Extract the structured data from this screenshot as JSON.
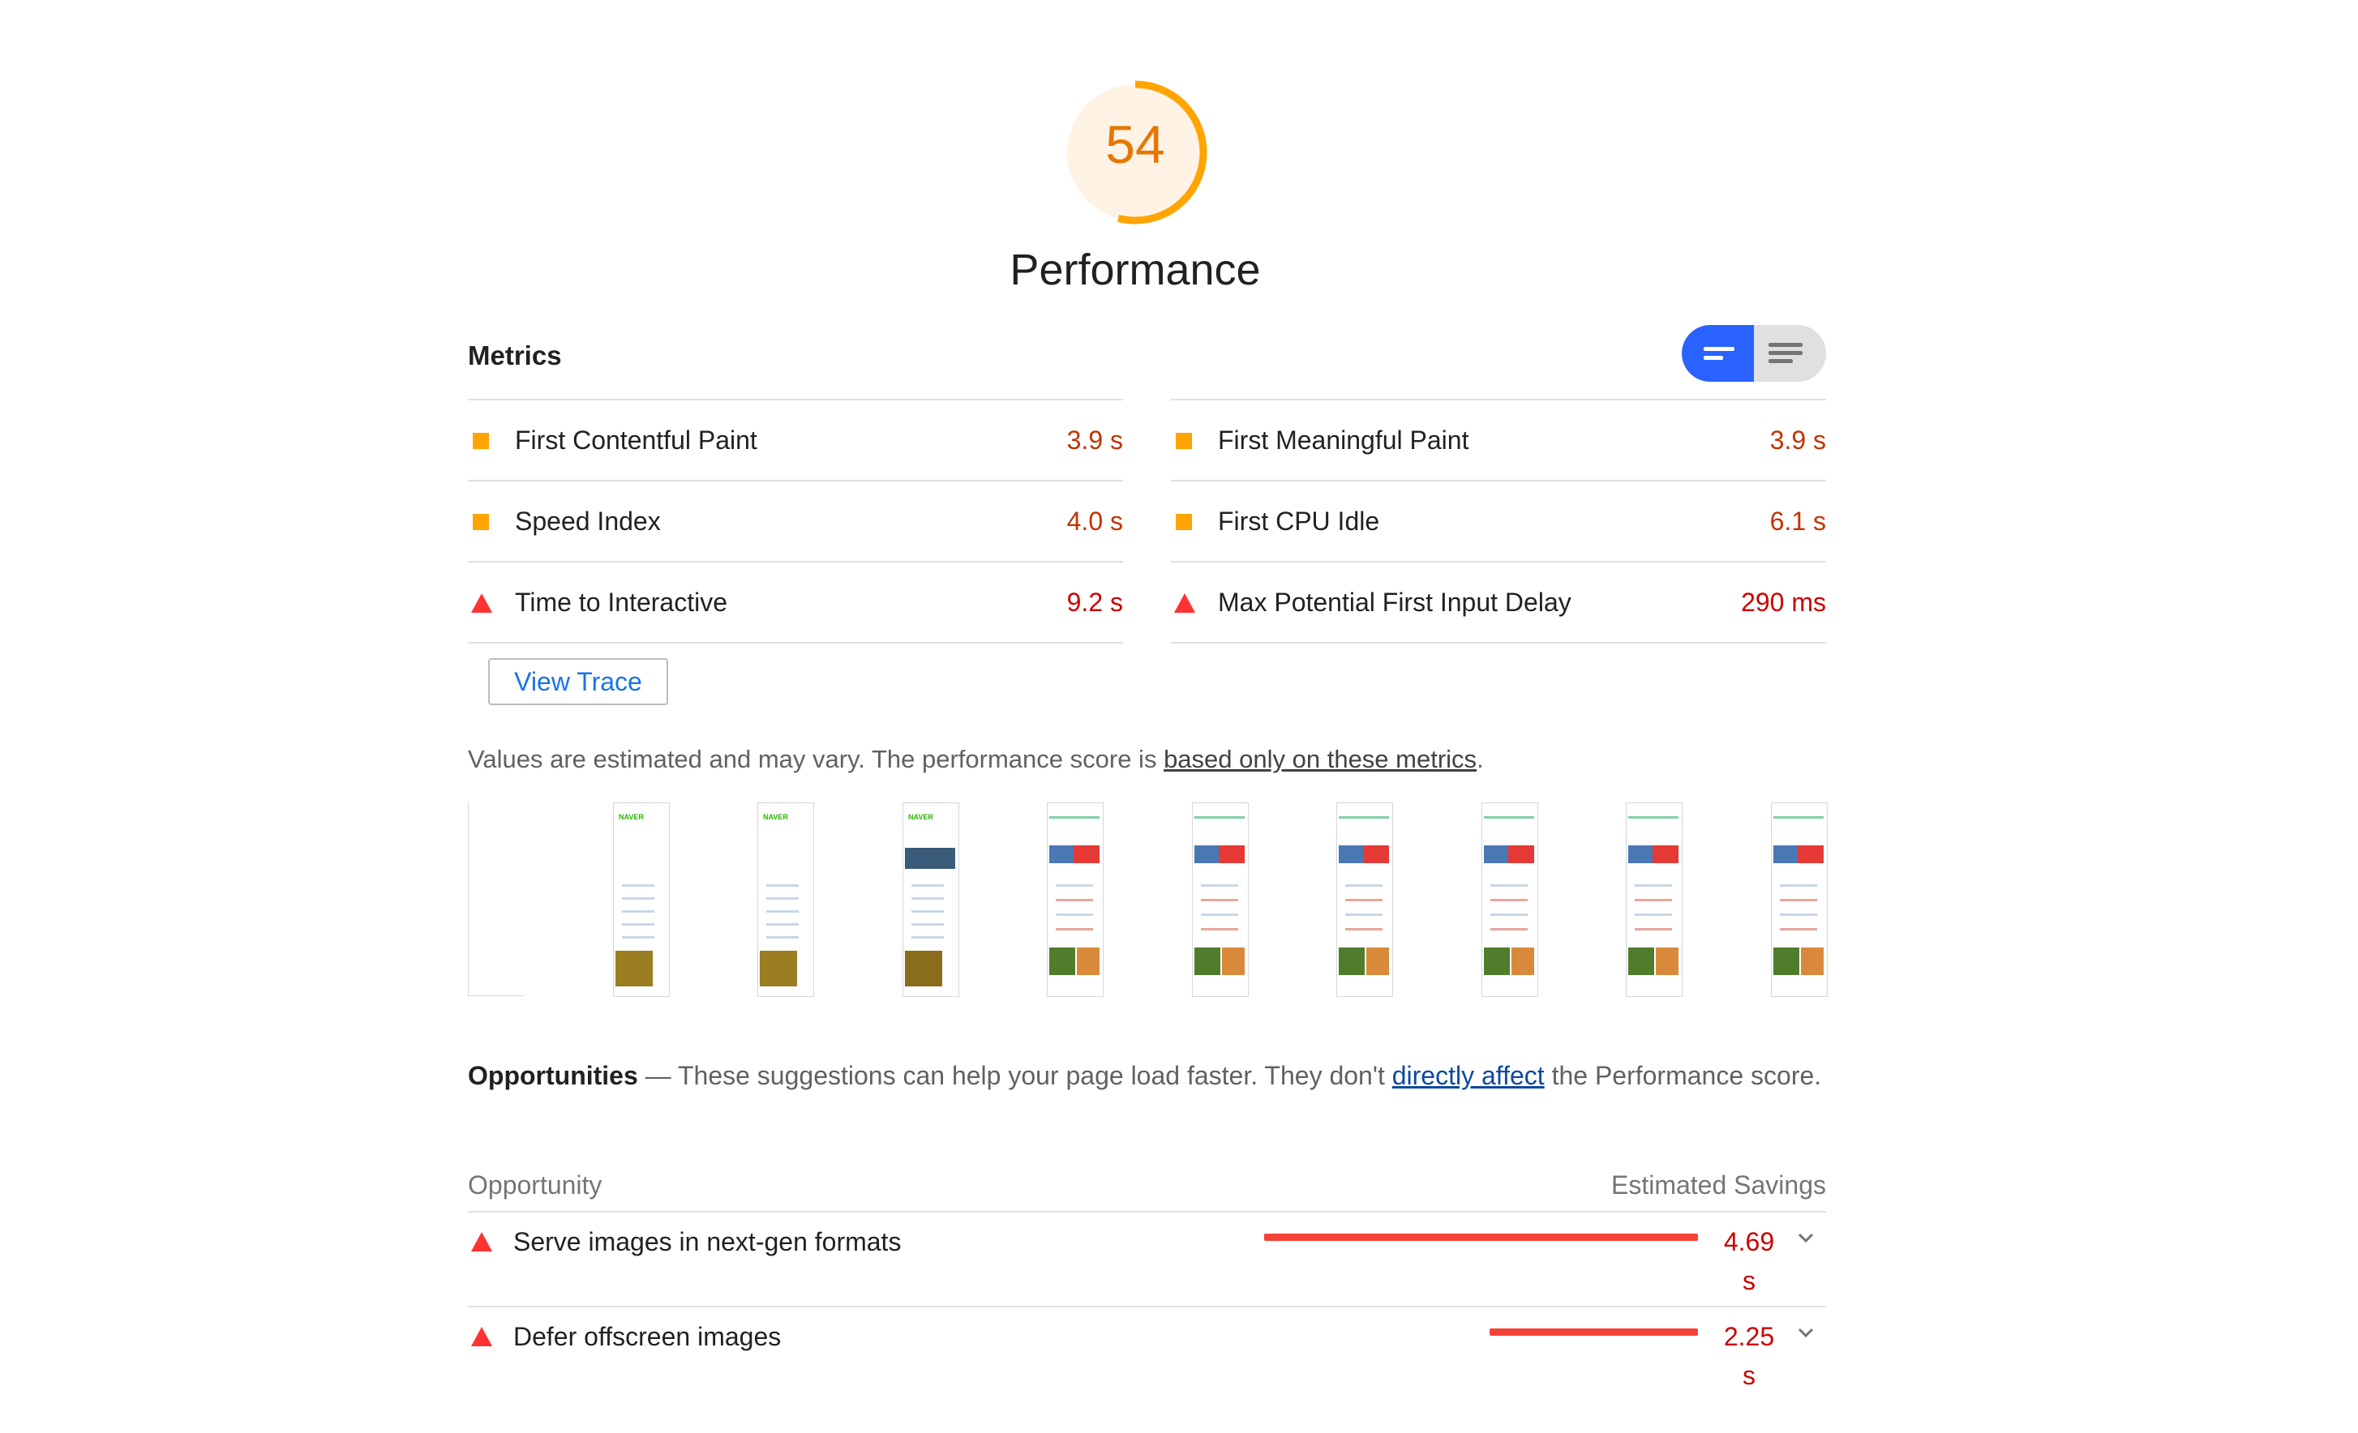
{
  "gauge": {
    "score": "54",
    "score_fraction": 0.54,
    "color": "#ffa400",
    "title": "Performance"
  },
  "metrics": {
    "title": "Metrics",
    "toggle": {
      "compact_icon": "compact-list-icon",
      "full_icon": "full-list-icon"
    },
    "left": [
      {
        "label": "First Contentful Paint",
        "value": "3.9 s",
        "rating": "average"
      },
      {
        "label": "Speed Index",
        "value": "4.0 s",
        "rating": "average"
      },
      {
        "label": "Time to Interactive",
        "value": "9.2 s",
        "rating": "fail"
      }
    ],
    "right": [
      {
        "label": "First Meaningful Paint",
        "value": "3.9 s",
        "rating": "average"
      },
      {
        "label": "First CPU Idle",
        "value": "6.1 s",
        "rating": "average"
      },
      {
        "label": "Max Potential First Input Delay",
        "value": "290 ms",
        "rating": "fail"
      }
    ]
  },
  "view_trace_label": "View Trace",
  "estimate_note": {
    "prefix": "Values are estimated and may vary. The performance score is ",
    "link": "based only on these metrics",
    "suffix": "."
  },
  "filmstrip": {
    "frame_count": 10,
    "logo_text": "NAVER"
  },
  "opportunities": {
    "heading_bold": "Opportunities",
    "heading_dash": " — ",
    "heading_text": "These suggestions can help your page load faster. They don't ",
    "heading_link": "directly affect",
    "heading_suffix": " the Performance score.",
    "col_left": "Opportunity",
    "col_right": "Estimated Savings",
    "items": [
      {
        "label": "Serve images in next-gen formats",
        "value": "4.69",
        "unit": "s",
        "fraction": 1.0
      },
      {
        "label": "Defer offscreen images",
        "value": "2.25",
        "unit": "s",
        "fraction": 0.48
      }
    ]
  },
  "colors": {
    "average": "#ffa400",
    "fail": "#ff3333",
    "accent": "#2962ff"
  }
}
